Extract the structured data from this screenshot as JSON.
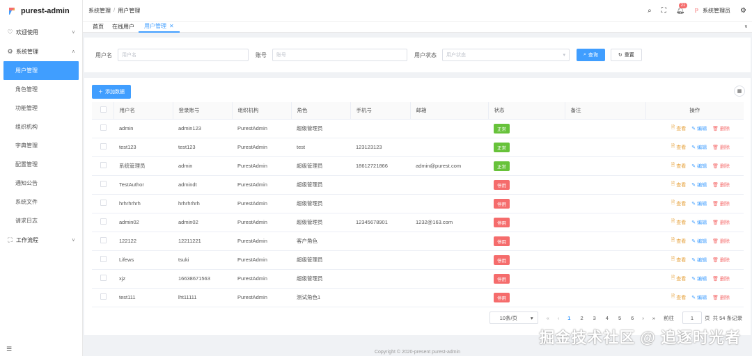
{
  "app": {
    "title": "purest-admin"
  },
  "sidebar": {
    "welcome": "欢迎使用",
    "system": "系统管理",
    "items": [
      "用户管理",
      "角色管理",
      "功能管理",
      "组织机构",
      "字典管理",
      "配置管理",
      "通知公告",
      "系统文件",
      "请求日志"
    ],
    "workflow": "工作流程"
  },
  "header": {
    "breadcrumb": [
      "系统管理",
      "用户管理"
    ],
    "notifications": "21",
    "username": "系统管理员"
  },
  "tabs": [
    "首页",
    "在线用户",
    "用户管理"
  ],
  "search": {
    "username_label": "用户名",
    "username_placeholder": "用户名",
    "account_label": "账号",
    "account_placeholder": "账号",
    "status_label": "用户状态",
    "status_placeholder": "用户状态",
    "query": "查询",
    "reset": "重置"
  },
  "table": {
    "add": "添加数据",
    "columns": [
      "用户名",
      "登录账号",
      "组织机构",
      "角色",
      "手机号",
      "邮箱",
      "状态",
      "备注",
      "操作"
    ],
    "ops": {
      "view": "查看",
      "edit": "编辑",
      "delete": "删除"
    },
    "status_labels": {
      "on": "正常",
      "off": "停用"
    },
    "rows": [
      [
        "admin",
        "admin123",
        "PurestAdmin",
        "超级管理员",
        "",
        "",
        "on",
        ""
      ],
      [
        "test123",
        "test123",
        "PurestAdmin",
        "test",
        "123123123",
        "",
        "on",
        ""
      ],
      [
        "系统管理员",
        "admin",
        "PurestAdmin",
        "超级管理员",
        "18612721866",
        "admin@purest.com",
        "on",
        ""
      ],
      [
        "TestAuthor",
        "admindt",
        "PurestAdmin",
        "超级管理员",
        "",
        "",
        "off",
        ""
      ],
      [
        "hrhrhrhrh",
        "hrhrhrhrh",
        "PurestAdmin",
        "超级管理员",
        "",
        "",
        "off",
        ""
      ],
      [
        "admin02",
        "admin02",
        "PurestAdmin",
        "超级管理员",
        "12345678901",
        "1232@163.com",
        "off",
        ""
      ],
      [
        "122122",
        "12211221",
        "PurestAdmin",
        "客户角色",
        "",
        "",
        "off",
        ""
      ],
      [
        "Lifews",
        "tsuki",
        "PurestAdmin",
        "超级管理员",
        "",
        "",
        "off",
        ""
      ],
      [
        "xjz",
        "16638671563",
        "PurestAdmin",
        "超级管理员",
        "",
        "",
        "off",
        ""
      ],
      [
        "test111",
        "lht11111",
        "PurestAdmin",
        "测试角色1",
        "",
        "",
        "off",
        ""
      ]
    ]
  },
  "pagination": {
    "page_size": "10条/页",
    "pages": [
      "1",
      "2",
      "3",
      "4",
      "5",
      "6"
    ],
    "goto_label": "前往",
    "goto_value": "1",
    "page_unit": "页",
    "total": "共 54 条记录"
  },
  "footer": "Copyright © 2020-present purest-admin",
  "watermark": "掘金技术社区 @ 追逐时光者"
}
